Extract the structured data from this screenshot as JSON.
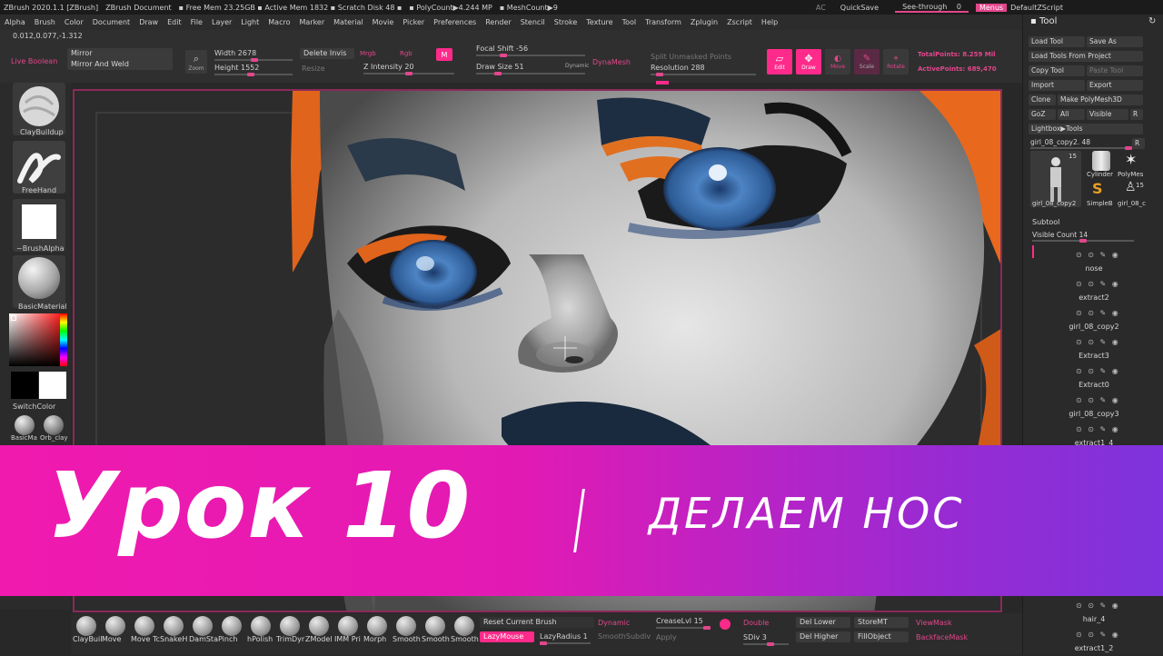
{
  "titlebar": {
    "app": "ZBrush 2020.1.1 [ZBrush]",
    "doc": "ZBrush Document",
    "stats": "▪ Free Mem 23.25GB ▪ Active Mem 1832 ▪ Scratch Disk 48 ▪",
    "polycount": "▪ PolyCount▶4.244 MP",
    "meshcount": "▪ MeshCount▶9",
    "ac": "AC",
    "quicksave": "QuickSave",
    "seethrough": "See-through",
    "seethrough_val": "0",
    "menus": "Menus",
    "script": "DefaultZScript"
  },
  "menubar": [
    "Alpha",
    "Brush",
    "Color",
    "Document",
    "Draw",
    "Edit",
    "File",
    "Layer",
    "Light",
    "Macro",
    "Marker",
    "Material",
    "Movie",
    "Picker",
    "Preferences",
    "Render",
    "Stencil",
    "Stroke",
    "Texture",
    "Tool",
    "Transform",
    "Zplugin",
    "Zscript",
    "Help"
  ],
  "coords": "0.012,0.077,-1.312",
  "topshelf": {
    "live_boolean": "Live Boolean",
    "mirror": "Mirror",
    "mirror_weld": "Mirror And Weld",
    "zoom": "Zoom",
    "width_label": "Width",
    "width_val": "2678",
    "height_label": "Height",
    "height_val": "1552",
    "delete_invis": "Delete Invis",
    "resize": "Resize",
    "mrgb": "Mrgb",
    "rgb": "Rgb",
    "m": "M",
    "z_intensity_label": "Z Intensity",
    "z_intensity_val": "20",
    "focal_shift_label": "Focal Shift",
    "focal_shift_val": "-56",
    "draw_size_label": "Draw Size",
    "draw_size_val": "51",
    "dynamic": "Dynamic",
    "dynamesh": "DynaMesh",
    "split_unmasked": "Split Unmasked Points",
    "resolution_label": "Resolution",
    "resolution_val": "288",
    "edit": "Edit",
    "draw": "Draw",
    "move": "Move",
    "scale": "Scale",
    "rotate": "Rotate",
    "total_points": "TotalPoints: 8.259 Mil",
    "active_points": "ActivePoints: 689,470"
  },
  "leftshelf": {
    "brush": "ClayBuildup",
    "stroke": "FreeHand",
    "alpha": "~BrushAlpha",
    "material": "BasicMaterial",
    "switch_color": "SwitchColor",
    "mat1": "BasicMa",
    "mat2": "Orb_clay"
  },
  "rightpanel": {
    "title": "Tool",
    "load_tool": "Load Tool",
    "save_as": "Save As",
    "load_from_project": "Load Tools From Project",
    "copy_tool": "Copy Tool",
    "paste_tool": "Paste Tool",
    "import": "Import",
    "export": "Export",
    "clone": "Clone",
    "make_polymesh": "Make PolyMesh3D",
    "goz": "GoZ",
    "all": "All",
    "visible": "Visible",
    "r": "R",
    "lightbox_tools": "Lightbox▶Tools",
    "current_tool": "girl_08_copy2.",
    "current_tool_val": "48",
    "thumb_count1": "15",
    "thumb_count2": "15",
    "thumb_girl": "girl_08_copy2",
    "thumb_cyl": "Cylinder",
    "thumb_poly": "PolyMes",
    "thumb_simpleb": "SimpleB",
    "thumb_girl2": "girl_08_c",
    "subtool": "Subtool",
    "visible_count_label": "Visible Count",
    "visible_count_val": "14",
    "subtools": [
      "nose",
      "extract2",
      "girl_08_copy2",
      "Extract3",
      "Extract0",
      "girl_08_copy3",
      "extract1_4"
    ],
    "subtools_bottom": [
      "hair_4",
      "extract1_2"
    ]
  },
  "bottomshelf": {
    "brushes": [
      "ClayBuil",
      "Move",
      "Move Tc",
      "SnakeH",
      "DamSta",
      "Pinch",
      "hPolish",
      "TrimDyr",
      "ZModel",
      "IMM Pri",
      "Morph",
      "Smooth",
      "Smooth",
      "Smooth"
    ],
    "reset_brush": "Reset Current Brush",
    "lazymouse": "LazyMouse",
    "lazyradius": "LazyRadius",
    "lazyradius_val": "1",
    "dynamic": "Dynamic",
    "smooth_subdiv": "SmoothSubdiv",
    "crease_label": "CreaseLvl",
    "crease_val": "15",
    "apply": "Apply",
    "double": "Double",
    "sdiv_label": "SDiv",
    "sdiv_val": "3",
    "del_lower": "Del Lower",
    "del_higher": "Del Higher",
    "store_mt": "StoreMT",
    "fill_object": "FillObject",
    "view_mask": "ViewMask",
    "backface_mask": "BackfaceMask"
  },
  "banner": {
    "title": "Урок 10",
    "subtitle": "ДЕЛАЕМ НОС"
  },
  "colors": {
    "accent": "#ff2a8a",
    "banner_left": "#f01aae",
    "banner_right": "#7e33dc",
    "viewport_border": "#8a2a5a"
  }
}
